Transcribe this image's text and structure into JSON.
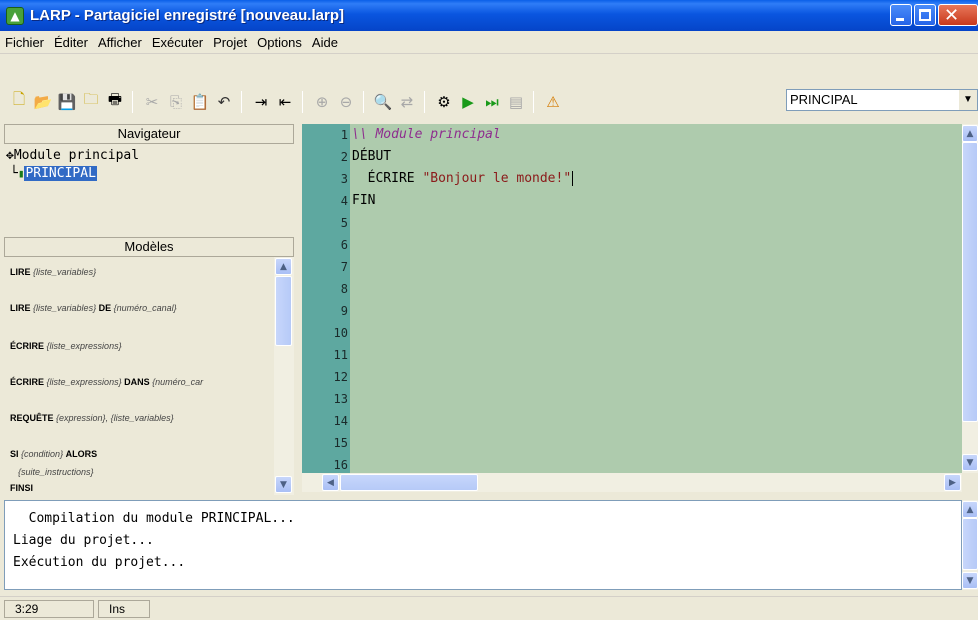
{
  "window": {
    "title": "LARP - Partagiciel enregistré [nouveau.larp]",
    "app_icon": "larp-app-icon"
  },
  "menu": [
    "Fichier",
    "Éditer",
    "Afficher",
    "Exécuter",
    "Projet",
    "Options",
    "Aide"
  ],
  "toolbar": {
    "module_selected": "PRINCIPAL",
    "icons": [
      "new-file-icon",
      "open-project-icon",
      "save-icon",
      "open-folder-icon",
      "print-icon",
      "cut-icon",
      "copy-icon",
      "paste-icon",
      "undo-icon",
      "indent-icon",
      "outdent-icon",
      "zoom-in-icon",
      "zoom-out-icon",
      "find-icon",
      "replace-icon",
      "compile-icon",
      "run-icon",
      "step-icon",
      "output-icon",
      "help-icon"
    ]
  },
  "navigator": {
    "header": "Navigateur",
    "root": "Module principal",
    "child": "PRINCIPAL"
  },
  "models": {
    "header": "Modèles",
    "items": [
      {
        "kw": "LIRE",
        "arg": "{liste_variables}"
      },
      {
        "kw": "LIRE",
        "arg": "{liste_variables}",
        "kw2": "DE",
        "arg2": "{numéro_canal}"
      },
      {
        "kw": "ÉCRIRE",
        "arg": "{liste_expressions}"
      },
      {
        "kw": "ÉCRIRE",
        "arg": "{liste_expressions}",
        "kw2": "DANS",
        "arg2": "{numéro_car"
      },
      {
        "kw": "REQUÊTE",
        "arg": "{expression}, {liste_variables}"
      },
      {
        "kw": "SI",
        "arg": "{condition}",
        "kw2": "ALORS"
      },
      {
        "arg": "{suite_instructions}"
      },
      {
        "kw": "FINSI"
      }
    ]
  },
  "editor": {
    "line_numbers": [
      "1",
      "2",
      "3",
      "4",
      "5",
      "6",
      "7",
      "8",
      "9",
      "10",
      "11",
      "12",
      "13",
      "14",
      "15",
      "16"
    ],
    "lines": [
      {
        "comment": "\\\\ Module principal"
      },
      {
        "code": "DÉBUT"
      },
      {
        "code": "  ÉCRIRE ",
        "string": "\"Bonjour le monde!\""
      },
      {
        "code": "FIN"
      }
    ]
  },
  "output": {
    "lines": [
      "  Compilation du module PRINCIPAL...",
      "Liage du projet...",
      "Exécution du projet..."
    ]
  },
  "status": {
    "position": "3:29",
    "mode": "Ins"
  }
}
